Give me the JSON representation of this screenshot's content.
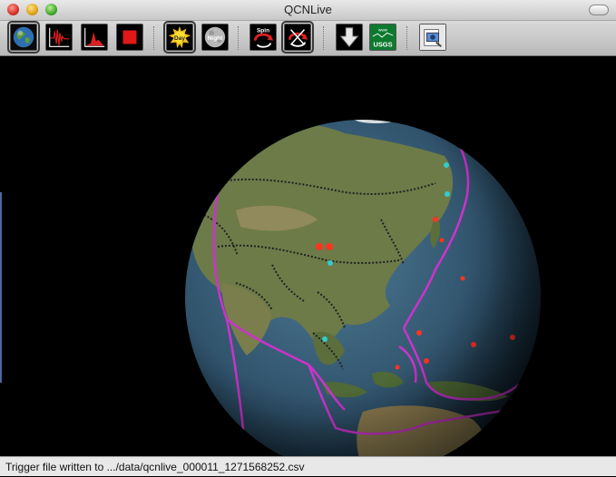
{
  "window": {
    "title": "QCNLive"
  },
  "toolbar": {
    "buttons": [
      {
        "id": "earth",
        "icon": "earth-globe-icon"
      },
      {
        "id": "sensor-2d",
        "icon": "seismogram-2d-icon"
      },
      {
        "id": "sensor-3d",
        "icon": "seismogram-3d-icon"
      },
      {
        "id": "cube",
        "icon": "red-cube-icon"
      },
      {
        "id": "day",
        "label": "Day",
        "icon": "sun-day-icon"
      },
      {
        "id": "night",
        "label": "Night",
        "icon": "moon-night-icon"
      },
      {
        "id": "spin",
        "label": "Spin",
        "icon": "spin-arrows-icon"
      },
      {
        "id": "spin-stop",
        "icon": "spin-stop-icon"
      },
      {
        "id": "download",
        "icon": "down-arrow-icon"
      },
      {
        "id": "usgs",
        "label": "USGS",
        "sublabel": "www",
        "icon": "usgs-icon"
      },
      {
        "id": "screenshot",
        "icon": "camera-screenshot-icon"
      }
    ]
  },
  "status": {
    "text": "Trigger file written to .../data/qcnlive_000011_1271568252.csv"
  },
  "colors": {
    "plate_boundary": "#cc33cc",
    "quake_recent": "#ff3322",
    "quake_cyan": "#33cccc",
    "ocean": "#3b5f7a",
    "land": "#6f7a4c"
  }
}
